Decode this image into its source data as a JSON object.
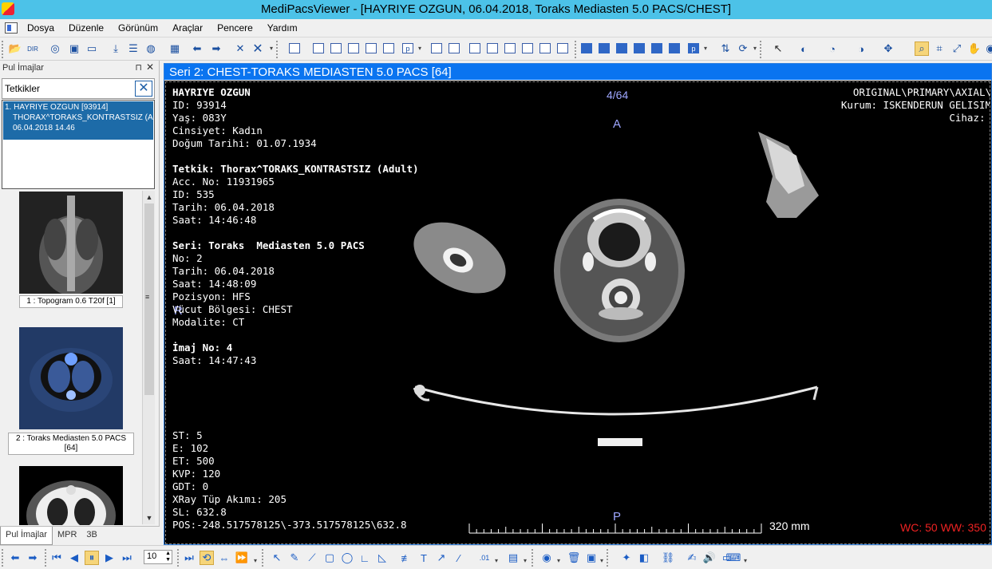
{
  "window": {
    "title": "MediPacsViewer - [HAYRIYE OZGUN, 06.04.2018, Toraks  Mediasten 5.0 PACS/CHEST]"
  },
  "menu": [
    "Dosya",
    "Düzenle",
    "Görünüm",
    "Araçlar",
    "Pencere",
    "Yardım"
  ],
  "left_panel": {
    "title": "Pul İmajlar",
    "search_value": "Tetkikler",
    "study": {
      "line1": "1. HAYRIYE OZGUN [93914]",
      "line2": "THORAX^TORAKS_KONTRASTSIZ (A",
      "line3": "06.04.2018 14.46"
    },
    "thumbs": [
      {
        "label": "1 : Topogram  0.6  T20f [1]"
      },
      {
        "label": "2 : Toraks  Mediasten 5.0 PACS [64]"
      }
    ],
    "tabs": [
      "Pul İmajlar",
      "MPR",
      "3B"
    ]
  },
  "viewer": {
    "header": "Seri 2: CHEST-TORAKS  MEDIASTEN 5.0 PACS [64]",
    "image_index": "4/64",
    "orientation": {
      "top": "A",
      "bottom": "P",
      "left": "R"
    },
    "patient": {
      "name": "HAYRIYE OZGUN",
      "id": "ID: 93914",
      "age": "Yaş: 083Y",
      "sex": "Cinsiyet: Kadın",
      "dob": "Doğum Tarihi: 01.07.1934"
    },
    "study": {
      "title": "Tetkik: Thorax^TORAKS_KONTRASTSIZ (Adult)",
      "acc": "Acc. No: 11931965",
      "id": "ID: 535",
      "date": "Tarih: 06.04.2018",
      "time": "Saat: 14:46:48"
    },
    "series": {
      "title": "Seri: Toraks  Mediasten 5.0 PACS",
      "no": "No: 2",
      "date": "Tarih: 06.04.2018",
      "time": "Saat: 14:48:09",
      "position": "Pozisyon: HFS",
      "body": "Vücut Bölgesi: CHEST",
      "modality": "Modalite: CT"
    },
    "image": {
      "title": "İmaj No: 4",
      "time": "Saat: 14:47:43"
    },
    "tech": [
      "ST: 5",
      "E: 102",
      "ET: 500",
      "KVP: 120",
      "GDT: 0",
      "XRay Tüp Akımı: 205",
      "SL: 632.8",
      "POS:-248.517578125\\-373.517578125\\632.8"
    ],
    "top_right": [
      "ORIGINAL\\PRIMARY\\AXIAL\\",
      "Kurum: ISKENDERUN GELISIM",
      "Cihaz: "
    ],
    "scale": "320 mm",
    "wcww": "WC: 50 WW: 350"
  },
  "bottom_toolbar": {
    "frame_rate": "10"
  }
}
